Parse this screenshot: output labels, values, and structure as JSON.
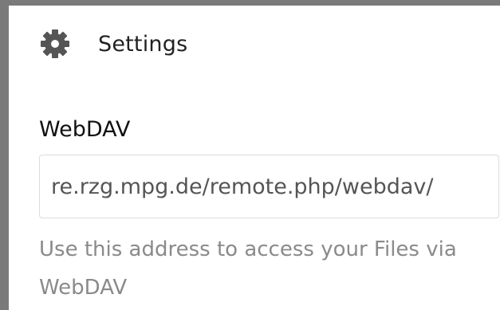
{
  "settings": {
    "label": "Settings",
    "icon": "gear-icon"
  },
  "webdav": {
    "label": "WebDAV",
    "url_value": "re.rzg.mpg.de/remote.php/webdav/",
    "hint": "Use this address to access your Files via WebDAV"
  },
  "colors": {
    "frame_border": "#7a7a7a",
    "gear": "#555555",
    "hint_text": "#8a8a8a"
  }
}
